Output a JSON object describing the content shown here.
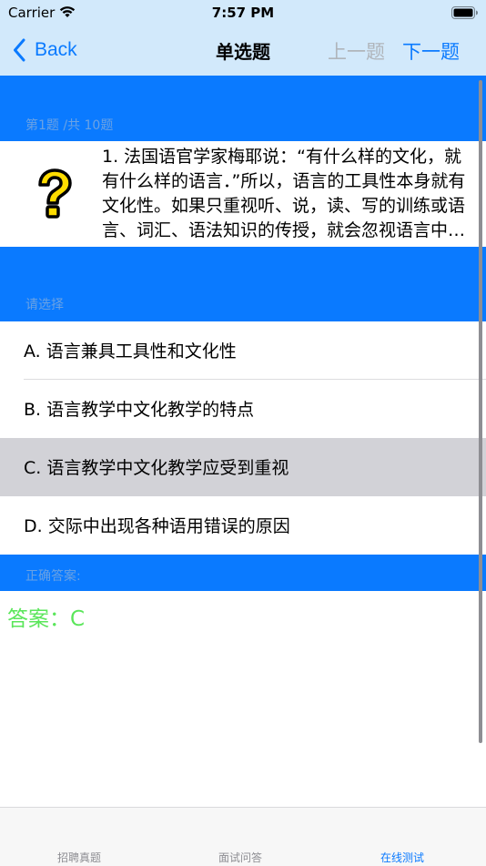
{
  "status_bar": {
    "carrier": "Carrier",
    "time": "7:57 PM",
    "icons": [
      "wifi-icon",
      "battery-icon"
    ]
  },
  "nav": {
    "back_label": "Back",
    "title": "单选题",
    "prev_label": "上一题",
    "next_label": "下一题",
    "prev_enabled": false
  },
  "question": {
    "counter": "第1题 /共 10题",
    "icon": "question-mark-icon",
    "text": "1. 法国语官学家梅耶说：“有什么样的文化，就有什么样的语言．”所以，语言的工具性本身就有文化性。如果只重视听、说，读、写的训练或语言、词汇、语法知识的传授，就会忽视语言中的文化因素。"
  },
  "choose_label": "请选择",
  "options": [
    {
      "label": "A.  语言兼具工具性和文化性",
      "selected": false
    },
    {
      "label": "B.  语言教学中文化教学的特点",
      "selected": false
    },
    {
      "label": "C.  语言教学中文化教学应受到重视",
      "selected": true
    },
    {
      "label": "D.  交际中出现各种语用错误的原因",
      "selected": false
    }
  ],
  "correct_label": "正确答案:",
  "answer_text": "答案：C",
  "tabs": [
    {
      "label": "招聘真题",
      "active": false
    },
    {
      "label": "面试问答",
      "active": false
    },
    {
      "label": "在线测试",
      "active": true
    }
  ],
  "colors": {
    "accent": "#0a7aff",
    "nav_background": "#d2e9fb",
    "answer": "#5ae65a",
    "selected_row": "#d2d2d7"
  }
}
